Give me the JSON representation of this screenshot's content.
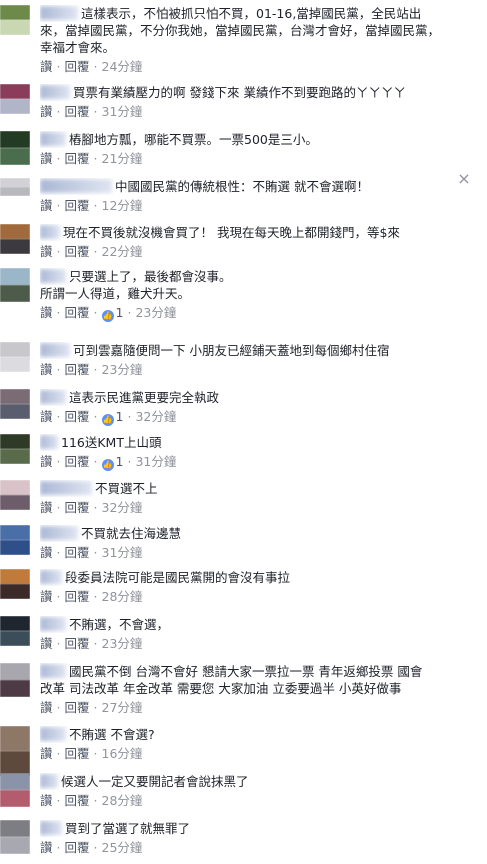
{
  "labels": {
    "like": "讚",
    "reply": "回覆",
    "close": "×"
  },
  "comments": [
    {
      "lines": [
        "這樣表示，不怕被抓只怕不買，01-16,當掉國民黨，全民站出",
        "來，當掉國民黨，不分你我她，當掉國民黨，台灣才會好，當掉國民黨，",
        "幸福才會來。"
      ],
      "timestamp": "24分鐘",
      "likes": "",
      "avatar": [
        "#6e8a4a",
        "#c9d7b2"
      ]
    },
    {
      "lines": [
        "買票有業績壓力的啊 發錢下來 業績作不到要跑路的ㄚㄚㄚㄚ"
      ],
      "timestamp": "31分鐘",
      "likes": "",
      "avatar": [
        "#8a3c5a",
        "#b0b5c8"
      ]
    },
    {
      "lines": [
        "樁腳地方瓢，哪能不買票。一票500是三小。"
      ],
      "timestamp": "21分鐘",
      "likes": "",
      "avatar": [
        "#233a23",
        "#4a6d4d"
      ]
    },
    {
      "lines": [
        "中國國民黨的傳統根性：不賄選 就不會選啊！"
      ],
      "timestamp": "12分鐘",
      "likes": "",
      "avatar": [
        "#d2d2d6",
        "#b8b8bf"
      ]
    },
    {
      "lines": [
        "現在不買後就沒機會買了！ 我現在每天晚上都開錢門，等$來"
      ],
      "timestamp": "22分鐘",
      "likes": "",
      "avatar": [
        "#a06a3c",
        "#3d3a3f"
      ]
    },
    {
      "lines": [
        "只要選上了，最後都會沒事。",
        "所謂一人得道，雞犬升天。"
      ],
      "timestamp": "23分鐘",
      "likes": "1",
      "avatar": [
        "#9bb6c9",
        "#4d5b4a"
      ]
    },
    {
      "lines": [
        "可到雲嘉隨便問一下 小朋友已經鋪天蓋地到每個鄉村住宿"
      ],
      "timestamp": "23分鐘",
      "likes": "",
      "avatar": [
        "#c8c8cc",
        "#dcdce0"
      ]
    },
    {
      "lines": [
        "這表示民進黨更要完全執政"
      ],
      "timestamp": "32分鐘",
      "likes": "1",
      "avatar": [
        "#7a6b74",
        "#5a5d6e"
      ]
    },
    {
      "lines": [
        "116送KMT上山頭"
      ],
      "timestamp": "31分鐘",
      "likes": "1",
      "avatar": [
        "#2f3a26",
        "#5a6b4c"
      ]
    },
    {
      "lines": [
        "不買選不上"
      ],
      "timestamp": "32分鐘",
      "likes": "",
      "avatar": [
        "#d9c3c8",
        "#6d5d6a"
      ]
    },
    {
      "lines": [
        "不買就去住海邊慧"
      ],
      "timestamp": "31分鐘",
      "likes": "",
      "avatar": [
        "#4a6fa8",
        "#2f4f8a"
      ]
    },
    {
      "lines": [
        "段委員法院可能是國民黨開的會沒有事拉"
      ],
      "timestamp": "28分鐘",
      "likes": "",
      "avatar": [
        "#c07a3a",
        "#3b2a28"
      ]
    },
    {
      "lines": [
        "不賄選，不會選，"
      ],
      "timestamp": "23分鐘",
      "likes": "",
      "avatar": [
        "#1f2630",
        "#3c4d5a"
      ]
    },
    {
      "lines": [
        "國民黨不倒 台灣不會好 懇請大家一票拉一票 青年返鄉投票 國會",
        "改革 司法改革 年金改革 需要您 大家加油 立委要過半 小英好做事"
      ],
      "timestamp": "27分鐘",
      "likes": "",
      "avatar": [
        "#a7a7ad",
        "#4e3a44"
      ]
    },
    {
      "lines": [
        "不賄選 不會選?"
      ],
      "timestamp": "16分鐘",
      "likes": "",
      "avatar": [
        "#8d7766",
        "#5e4a3c"
      ]
    },
    {
      "lines": [
        "候選人一定又要開記者會說抹黑了"
      ],
      "timestamp": "28分鐘",
      "likes": "",
      "avatar": [
        "#8a93a8",
        "#b35c6e"
      ]
    },
    {
      "lines": [
        "買到了當選了就無罪了"
      ],
      "timestamp": "25分鐘",
      "likes": "",
      "avatar": [
        "#7d7d84",
        "#a8a8b0"
      ]
    }
  ]
}
